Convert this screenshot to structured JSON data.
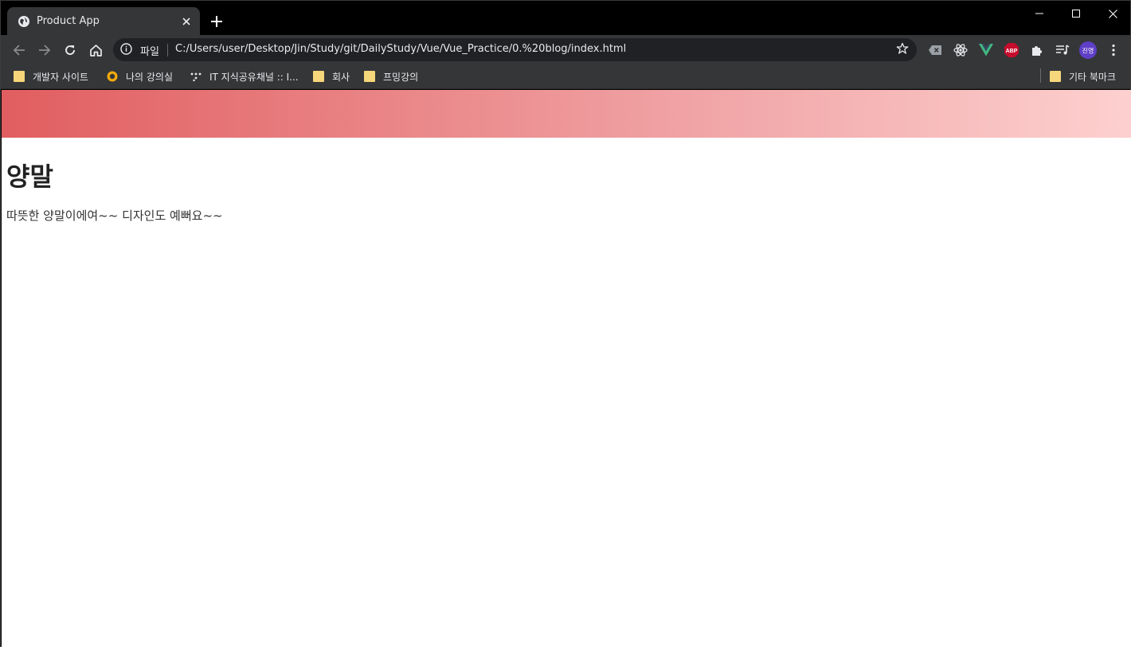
{
  "browser": {
    "tab": {
      "title": "Product App"
    },
    "omnibox": {
      "scheme_label": "파일",
      "url": "C:/Users/user/Desktop/Jin/Study/git/DailyStudy/Vue/Vue_Practice/0.%20blog/index.html"
    },
    "bookmarks": [
      {
        "label": "개발자 사이트",
        "icon": "folder-icon"
      },
      {
        "label": "나의 강의실",
        "icon": "site-icon"
      },
      {
        "label": "IT 지식공유채널 :: I...",
        "icon": "site-icon"
      },
      {
        "label": "회사",
        "icon": "folder-icon"
      },
      {
        "label": "프밍강의",
        "icon": "folder-icon"
      }
    ],
    "other_bookmarks_label": "기타 북마크",
    "profile_label": "진영",
    "abp_label": "ABP"
  },
  "page": {
    "heading": "양말",
    "description": "따뜻한 양말이에여~~ 디자인도 예뻐요~~"
  },
  "colors": {
    "banner_start": "#e15e60",
    "banner_end": "#fdd0cf",
    "chrome_dark": "#353638"
  }
}
